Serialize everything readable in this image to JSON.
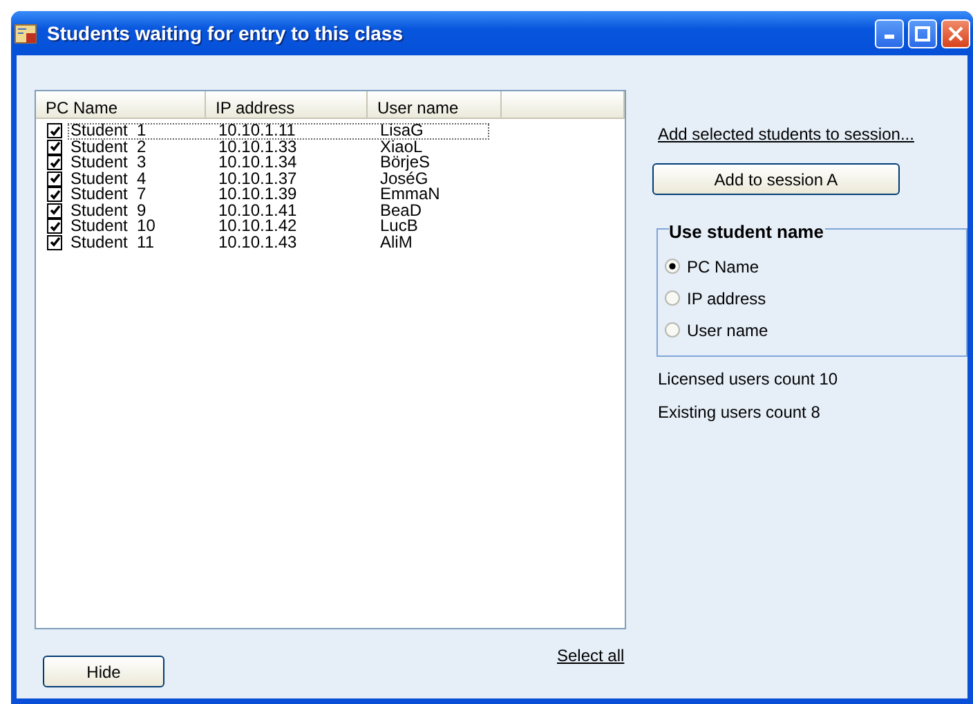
{
  "window": {
    "title": "Students waiting for entry to this class"
  },
  "table": {
    "columns": [
      "PC Name",
      "IP address",
      "User name"
    ],
    "rows": [
      {
        "pc_name": "Student  1",
        "ip_address": "10.10.1.11",
        "user_name": "LisaG",
        "checked": true,
        "focused": true
      },
      {
        "pc_name": "Student  2",
        "ip_address": "10.10.1.33",
        "user_name": "XiaoL",
        "checked": true,
        "focused": false
      },
      {
        "pc_name": "Student  3",
        "ip_address": "10.10.1.34",
        "user_name": "BörjeS",
        "checked": true,
        "focused": false
      },
      {
        "pc_name": "Student  4",
        "ip_address": "10.10.1.37",
        "user_name": "JoséG",
        "checked": true,
        "focused": false
      },
      {
        "pc_name": "Student  7",
        "ip_address": "10.10.1.39",
        "user_name": "EmmaN",
        "checked": true,
        "focused": false
      },
      {
        "pc_name": "Student  9",
        "ip_address": "10.10.1.41",
        "user_name": "BeaD",
        "checked": true,
        "focused": false
      },
      {
        "pc_name": "Student  10",
        "ip_address": "10.10.1.42",
        "user_name": "LucB",
        "checked": true,
        "focused": false
      },
      {
        "pc_name": "Student  11",
        "ip_address": "10.10.1.43",
        "user_name": "AliM",
        "checked": true,
        "focused": false
      }
    ]
  },
  "select_all_link": "Select all",
  "hide_button": "Hide",
  "add_link": "Add selected students to session...",
  "add_button": "Add to session A",
  "name_group": {
    "title": "Use student name",
    "options": [
      {
        "label": "PC Name",
        "selected": true
      },
      {
        "label": "IP address",
        "selected": false
      },
      {
        "label": "User name",
        "selected": false
      }
    ]
  },
  "licensed_count": "Licensed users count 10",
  "existing_count": "Existing users count  8"
}
